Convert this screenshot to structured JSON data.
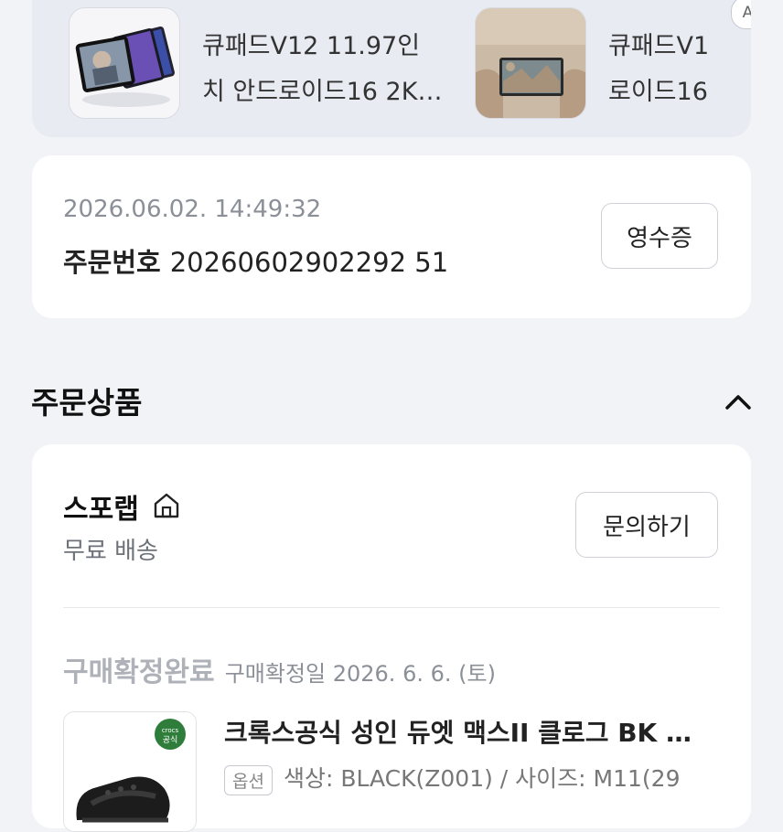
{
  "ads": {
    "badge": "AD",
    "items": [
      {
        "line1": "큐패드V12 11.97인",
        "line2": "치 안드로이드16 2K…"
      },
      {
        "line1": "큐패드V1",
        "line2": "로이드16"
      }
    ]
  },
  "order": {
    "timestamp": "2026.06.02. 14:49:32",
    "number_label": "주문번호",
    "number": "20260602902292 51",
    "receipt_button": "영수증"
  },
  "section": {
    "title": "주문상품"
  },
  "product_card": {
    "seller": "스포랩",
    "shipping": "무료 배송",
    "inquiry_button": "문의하기",
    "status": "구매확정완료",
    "confirm_date": "구매확정일 2026. 6. 6. (토)",
    "product_name": "크록스공식 성인 듀엣 맥스II 클로그 BK …",
    "option_tag": "옵션",
    "option_text": "색상: BLACK(Z001) / 사이즈: M11(29",
    "badge_top": "crocs",
    "badge_bottom": "공식"
  },
  "colors": {
    "background": "#f2f3f6",
    "card": "#ffffff",
    "ad_strip": "#e9ebf3",
    "muted_text": "#8b8f97",
    "status_gray": "#aeb1b8",
    "badge_green": "#2f7d3b"
  }
}
